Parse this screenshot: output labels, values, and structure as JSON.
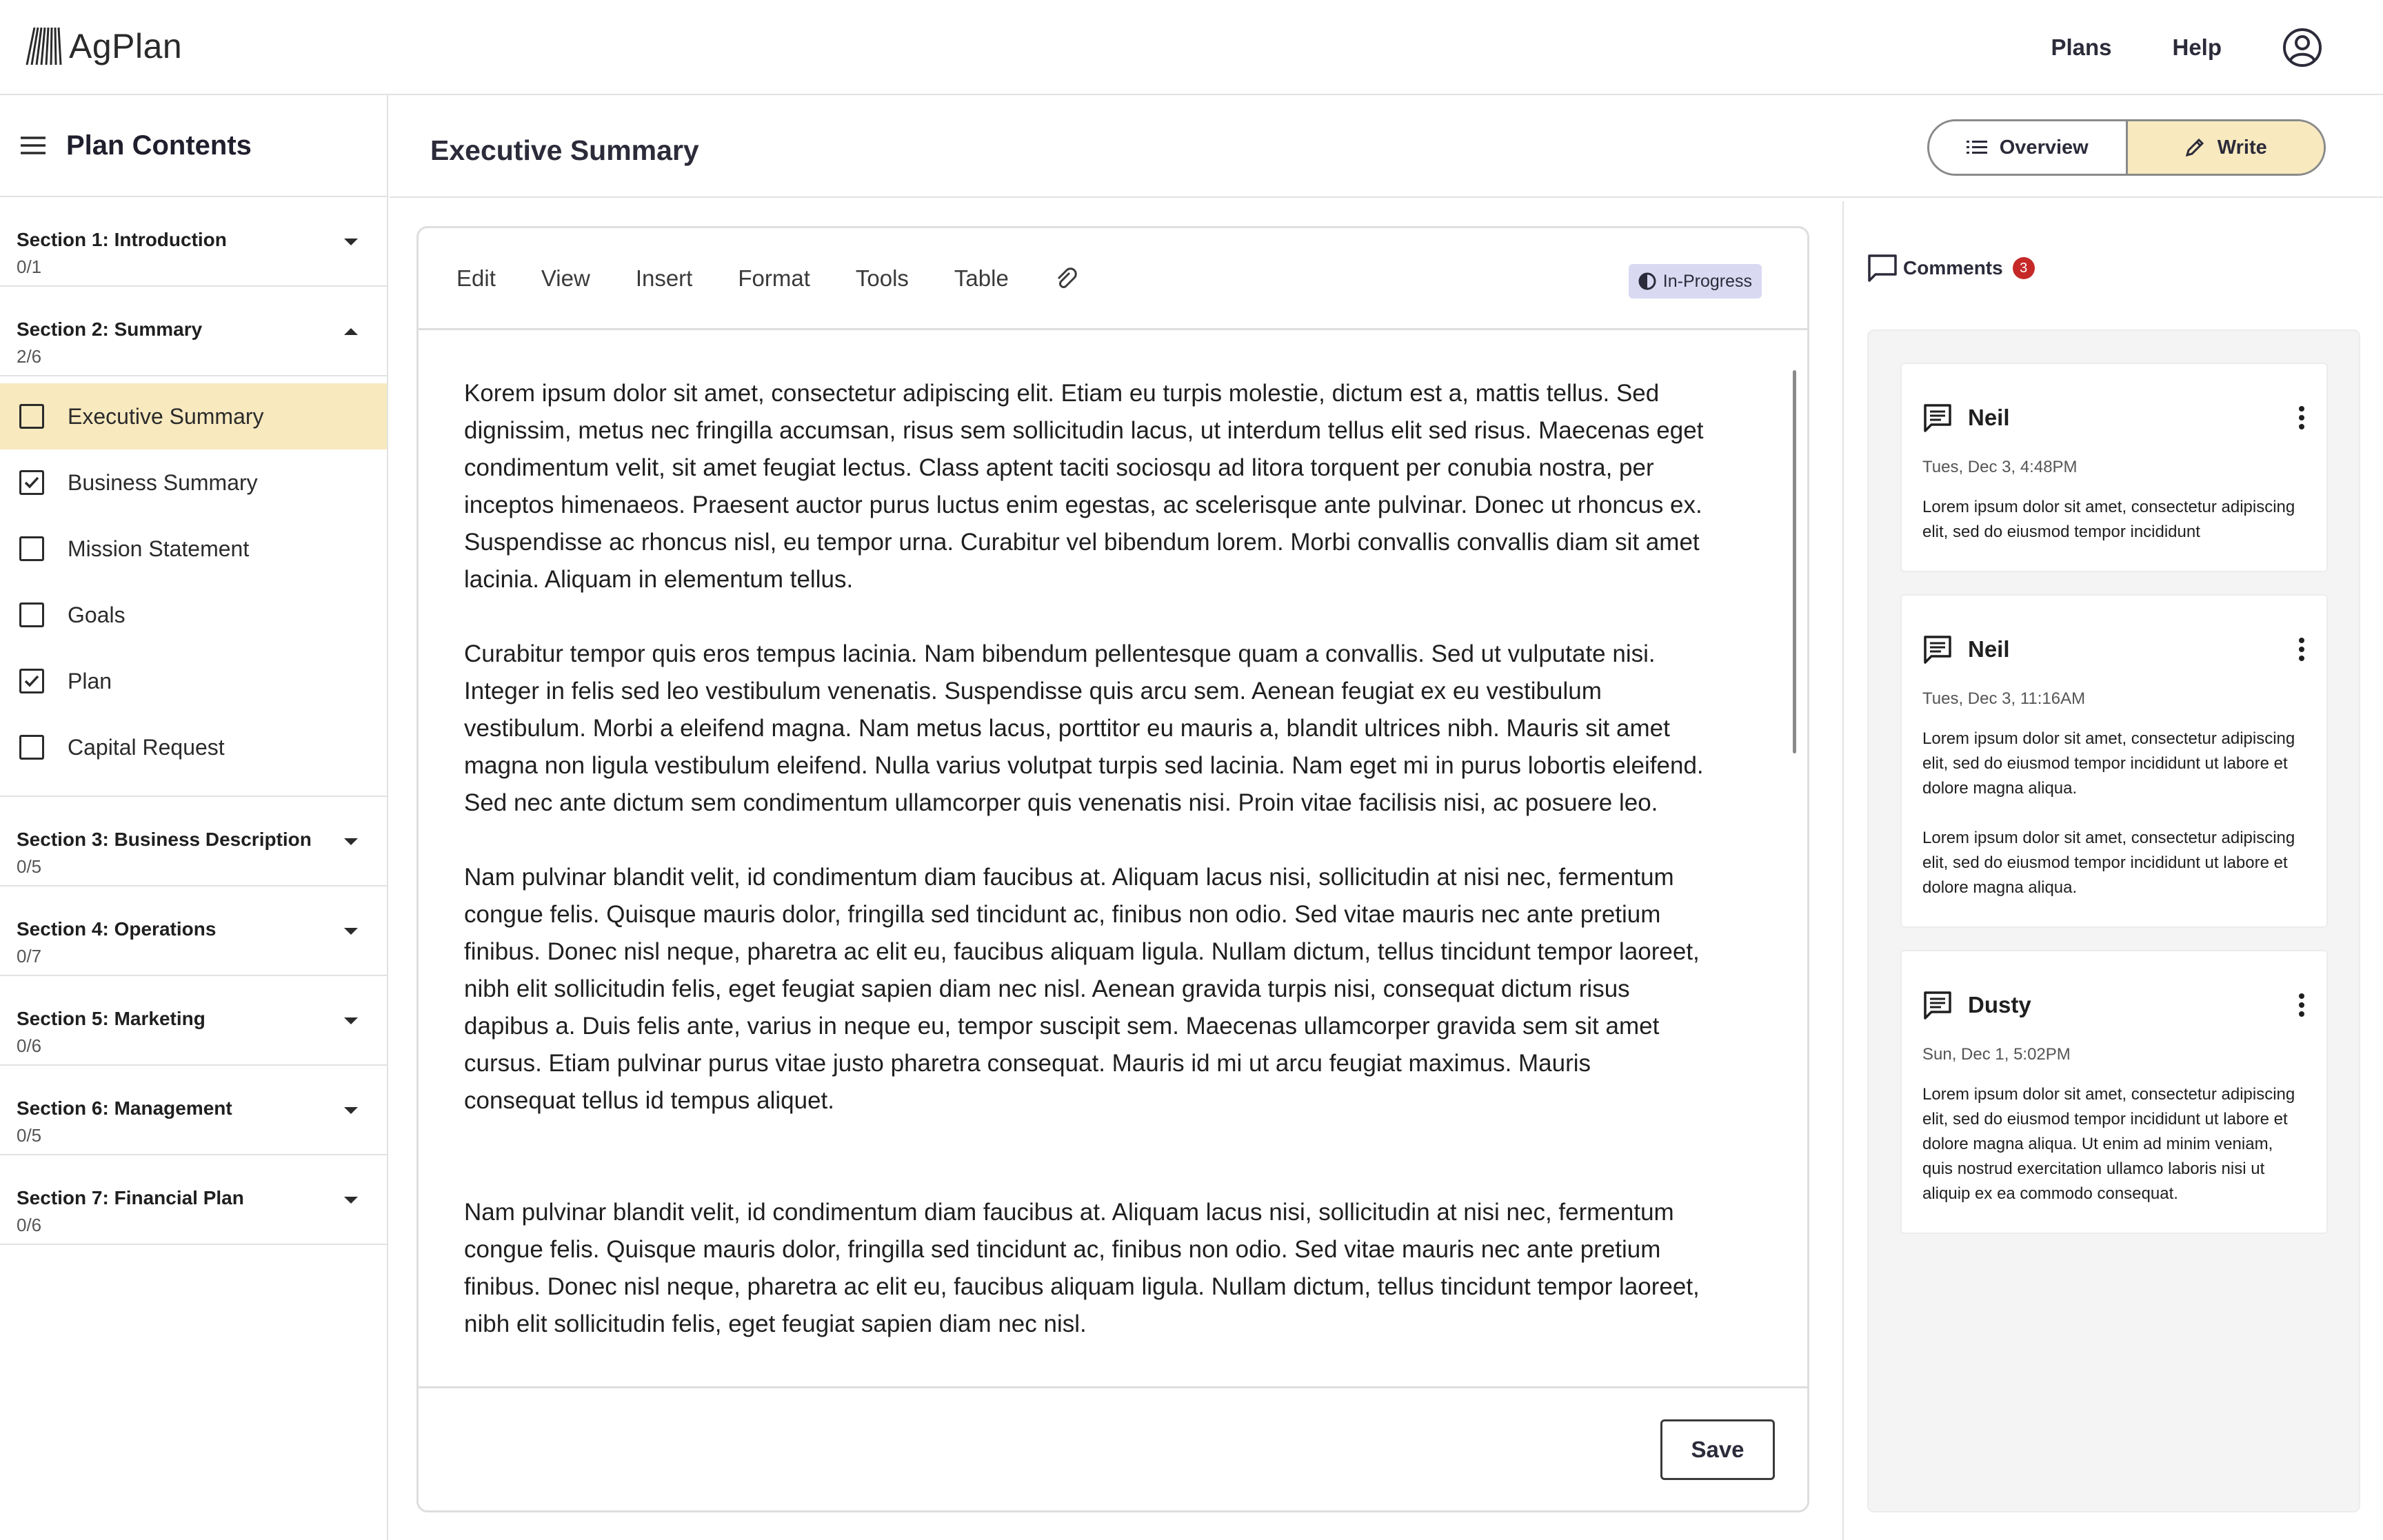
{
  "app": {
    "name": "AgPlan",
    "nav": [
      "Plans",
      "Help"
    ]
  },
  "sidebar": {
    "title": "Plan Contents",
    "sections": [
      {
        "title": "Section 1: Introduction",
        "progress": "0/1"
      },
      {
        "title": "Section 2: Summary",
        "progress": "2/6",
        "expanded": true,
        "items": [
          {
            "label": "Executive Summary",
            "checked": false,
            "active": true
          },
          {
            "label": "Business Summary",
            "checked": true
          },
          {
            "label": "Mission Statement",
            "checked": false
          },
          {
            "label": "Goals",
            "checked": false
          },
          {
            "label": "Plan",
            "checked": true
          },
          {
            "label": "Capital Request",
            "checked": false
          }
        ]
      },
      {
        "title": "Section 3: Business Description",
        "progress": "0/5"
      },
      {
        "title": "Section 4: Operations",
        "progress": "0/7"
      },
      {
        "title": "Section 5: Marketing",
        "progress": "0/6"
      },
      {
        "title": "Section 6: Management",
        "progress": "0/5"
      },
      {
        "title": "Section 7: Financial Plan",
        "progress": "0/6"
      }
    ]
  },
  "page": {
    "title": "Executive Summary",
    "view_toggle": {
      "overview": "Overview",
      "write": "Write",
      "selected": "Write"
    }
  },
  "editor": {
    "menus": [
      "Edit",
      "View",
      "Insert",
      "Format",
      "Tools",
      "Table"
    ],
    "status": "In-Progress",
    "paragraphs": [
      "Korem ipsum dolor sit amet, consectetur adipiscing elit. Etiam eu turpis molestie, dictum est a, mattis tellus. Sed dignissim, metus nec fringilla accumsan, risus sem sollicitudin lacus, ut interdum tellus elit sed risus. Maecenas eget condimentum velit, sit amet feugiat lectus. Class aptent taciti sociosqu ad litora torquent per conubia nostra, per inceptos himenaeos. Praesent auctor purus luctus enim egestas, ac scelerisque ante pulvinar. Donec ut rhoncus ex. Suspendisse ac rhoncus nisl, eu tempor urna. Curabitur vel bibendum lorem. Morbi convallis convallis diam sit amet lacinia. Aliquam in elementum tellus.",
      "Curabitur tempor quis eros tempus lacinia. Nam bibendum pellentesque quam a convallis. Sed ut vulputate nisi. Integer in felis sed leo vestibulum venenatis. Suspendisse quis arcu sem. Aenean feugiat ex eu vestibulum vestibulum. Morbi a eleifend magna. Nam metus lacus, porttitor eu mauris a, blandit ultrices nibh. Mauris sit amet magna non ligula vestibulum eleifend. Nulla varius volutpat turpis sed lacinia. Nam eget mi in purus lobortis eleifend. Sed nec ante dictum sem condimentum ullamcorper quis venenatis nisi. Proin vitae facilisis nisi, ac posuere leo.",
      " Nam pulvinar blandit velit, id condimentum diam faucibus at. Aliquam lacus nisi, sollicitudin at nisi nec, fermentum congue felis. Quisque mauris dolor, fringilla sed tincidunt ac, finibus non odio. Sed vitae mauris nec ante pretium finibus. Donec nisl neque, pharetra ac elit eu, faucibus aliquam ligula. Nullam dictum, tellus tincidunt tempor laoreet, nibh elit sollicitudin felis, eget feugiat sapien diam nec nisl. Aenean gravida turpis nisi, consequat dictum risus dapibus a. Duis felis ante, varius in neque eu, tempor suscipit sem. Maecenas ullamcorper gravida sem sit amet cursus. Etiam pulvinar purus vitae justo pharetra consequat. Mauris id mi ut arcu feugiat maximus. Mauris consequat tellus id tempus aliquet.",
      " Nam pulvinar blandit velit, id condimentum diam faucibus at. Aliquam lacus nisi, sollicitudin at nisi nec, fermentum congue felis. Quisque mauris dolor, fringilla sed tincidunt ac, finibus non odio. Sed vitae mauris nec ante pretium finibus. Donec nisl neque, pharetra ac elit eu, faucibus aliquam ligula. Nullam dictum, tellus tincidunt tempor laoreet, nibh elit sollicitudin felis, eget feugiat sapien diam nec nisl."
    ],
    "save_label": "Save"
  },
  "comments": {
    "title": "Comments",
    "count": "3",
    "items": [
      {
        "author": "Neil",
        "time": "Tues, Dec 3,  4:48PM",
        "texts": [
          "Lorem ipsum dolor sit amet, consectetur adipiscing elit, sed do eiusmod tempor incididunt"
        ]
      },
      {
        "author": "Neil",
        "time": "Tues, Dec 3,  11:16AM",
        "texts": [
          "Lorem ipsum dolor sit amet, consectetur adipiscing elit, sed do eiusmod tempor incididunt ut labore et dolore magna aliqua.",
          "Lorem ipsum dolor sit amet, consectetur adipiscing elit, sed do eiusmod tempor incididunt ut labore et dolore magna aliqua."
        ]
      },
      {
        "author": "Dusty",
        "time": "Sun, Dec 1,  5:02PM",
        "texts": [
          "Lorem ipsum dolor sit amet, consectetur adipiscing elit, sed do eiusmod tempor incididunt ut labore et dolore magna aliqua. Ut enim ad minim veniam, quis nostrud exercitation ullamco laboris nisi ut aliquip ex ea commodo consequat."
        ]
      }
    ]
  },
  "icons": {
    "logo": "agplan-logo-icon",
    "account": "user-circle-icon",
    "menu": "hamburger-icon",
    "attach": "paperclip-icon",
    "status": "half-circle-icon",
    "comment": "comment-icon",
    "more": "more-vertical-icon"
  },
  "colors": {
    "active_highlight": "#f8e9bf",
    "status_badge": "#d9d9f2",
    "comment_count_badge": "#c62828"
  }
}
